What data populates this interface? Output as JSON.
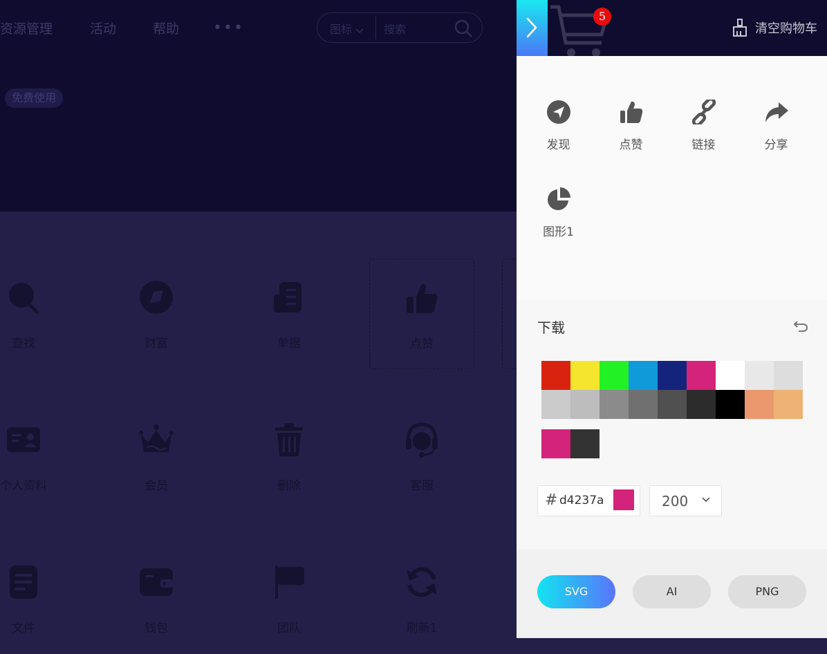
{
  "background": {
    "nav": [
      {
        "label": "资源管理"
      },
      {
        "label": "活动"
      },
      {
        "label": "帮助"
      }
    ],
    "more_label": "•••",
    "search": {
      "type_label": "图标",
      "placeholder": "搜索"
    },
    "badge": "免费使用",
    "tiles": [
      {
        "label": "查找",
        "icon": "search-icon"
      },
      {
        "label": "财富",
        "icon": "compass-icon"
      },
      {
        "label": "单据",
        "icon": "receipt-icon"
      },
      {
        "label": "点赞",
        "icon": "thumbs-up-icon",
        "selected": true
      },
      {
        "label": "个人资料",
        "icon": "id-card-icon"
      },
      {
        "label": "会员",
        "icon": "crown-icon"
      },
      {
        "label": "删除",
        "icon": "trash-icon"
      },
      {
        "label": "客服",
        "icon": "headset-icon"
      },
      {
        "label": "文件",
        "icon": "file-icon"
      },
      {
        "label": "钱包",
        "icon": "wallet-icon"
      },
      {
        "label": "团队",
        "icon": "flag-icon"
      },
      {
        "label": "刷新1",
        "icon": "refresh-icon"
      }
    ]
  },
  "drawer": {
    "cart_count": "5",
    "clear_label": "清空购物车",
    "items": [
      {
        "label": "发现",
        "icon": "navigation-icon"
      },
      {
        "label": "点赞",
        "icon": "thumbs-up-icon"
      },
      {
        "label": "链接",
        "icon": "link-icon"
      },
      {
        "label": "分享",
        "icon": "share-icon"
      },
      {
        "label": "图形1",
        "icon": "pie-chart-icon"
      }
    ],
    "download": {
      "title": "下载",
      "palette": [
        "#d9230f",
        "#f5e52c",
        "#22f224",
        "#119ad9",
        "#14247c",
        "#d4237a",
        "#ffffff",
        "#e8e8e8",
        "#dddddd",
        "#cbcbcb",
        "#bdbdbd",
        "#8b8b8b",
        "#707070",
        "#505050",
        "#2c2c2c",
        "#000000",
        "#eb986e",
        "#edb274"
      ],
      "recent": [
        "#d4237a",
        "#333333"
      ],
      "hash": "#",
      "hex_value": "d4237a",
      "current_color": "#d4237a",
      "size": "200",
      "formats": [
        {
          "label": "SVG",
          "active": true
        },
        {
          "label": "AI"
        },
        {
          "label": "PNG"
        }
      ]
    }
  }
}
